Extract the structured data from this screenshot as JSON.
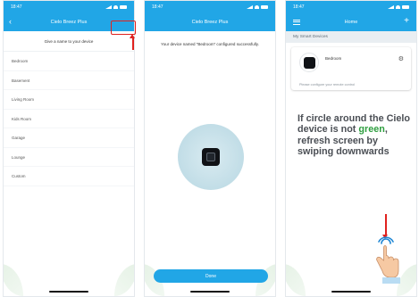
{
  "status": {
    "time": "18:47"
  },
  "screen1": {
    "title": "Cielo Breez Plus",
    "prompt": "Give a name to your device",
    "rooms": [
      "Bedroom",
      "Basement",
      "Living Room",
      "Kids Room",
      "Garage",
      "Lounge",
      "Custom"
    ]
  },
  "screen2": {
    "title": "Cielo Breez Plus",
    "message": "Your device named \"Bedroom\" configured successfully.",
    "done_label": "Done"
  },
  "screen3": {
    "title": "Home",
    "section": "My Smart Devices",
    "device_name": "Bedroom",
    "card_note": "Please configure your remote control"
  },
  "instruction": {
    "part1": "If circle around the Cielo device is not ",
    "green_word": "green",
    "part2": ", refresh screen by swiping downwards"
  },
  "colors": {
    "brand_blue": "#21a6e6",
    "highlight_red": "#e0221f",
    "green_text": "#2e9e3f"
  },
  "icons": [
    "back-arrow-icon",
    "menu-icon",
    "plus-icon",
    "gear-icon",
    "tap-hand-icon"
  ]
}
